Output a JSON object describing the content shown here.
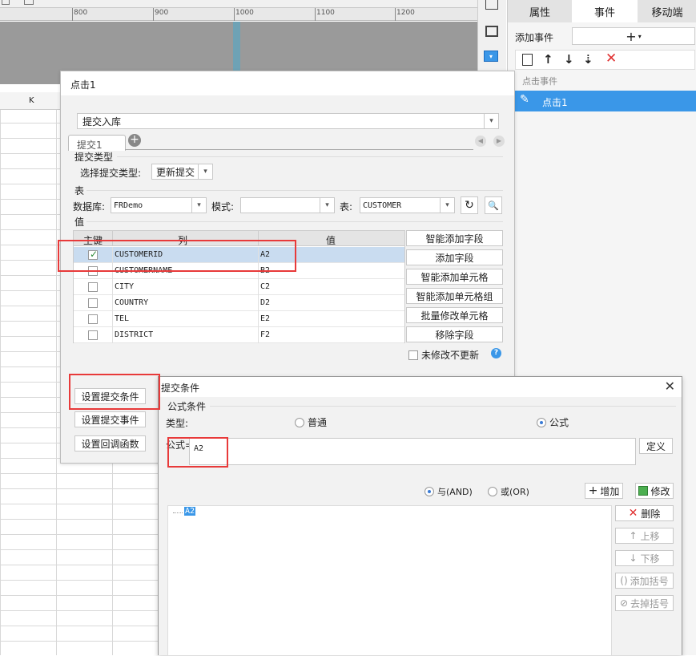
{
  "ruler": {
    "marks": [
      "800",
      "900",
      "1000",
      "1100",
      "1200"
    ]
  },
  "sheet": {
    "col_k": "K"
  },
  "right_panel": {
    "tabs": [
      "属性",
      "事件",
      "移动端"
    ],
    "add_event_label": "添加事件",
    "event_section": "点击事件",
    "event_item": "点击1"
  },
  "main_dialog": {
    "title": "点击1",
    "action_select": "提交入库",
    "tab_label": "提交1",
    "submit_type_group": "提交类型",
    "submit_type_label": "选择提交类型:",
    "submit_type_value": "更新提交",
    "table_group": "表",
    "db_label": "数据库:",
    "db_value": "FRDemo",
    "mode_label": "模式:",
    "mode_value": "",
    "table_label": "表:",
    "table_value": "CUSTOMER",
    "value_group": "值",
    "grid_headers": [
      "主键",
      "列",
      "值"
    ],
    "grid_rows": [
      {
        "key": true,
        "column": "CUSTOMERID",
        "value": "A2"
      },
      {
        "key": false,
        "column": "CUSTOMERNAME",
        "value": "B2"
      },
      {
        "key": false,
        "column": "CITY",
        "value": "C2"
      },
      {
        "key": false,
        "column": "COUNTRY",
        "value": "D2"
      },
      {
        "key": false,
        "column": "TEL",
        "value": "E2"
      },
      {
        "key": false,
        "column": "DISTRICT",
        "value": "F2"
      }
    ],
    "side_buttons": [
      "智能添加字段",
      "添加字段",
      "智能添加单元格",
      "智能添加单元格组",
      "批量修改单元格",
      "移除字段"
    ],
    "no_update_label": "未修改不更新",
    "bottom_buttons": [
      "设置提交条件",
      "设置提交事件",
      "设置回调函数"
    ]
  },
  "cond_dialog": {
    "title": "提交条件",
    "group_label": "公式条件",
    "type_label": "类型:",
    "radio_normal": "普通",
    "radio_formula": "公式",
    "formula_label": "公式=",
    "formula_value": "A2",
    "define_button": "定义",
    "and_label": "与(AND)",
    "or_label": "或(OR)",
    "add_button": "增加",
    "modify_button": "修改",
    "tree_item": "A2",
    "delete_button": "删除",
    "up_button": "上移",
    "down_button": "下移",
    "add_bracket_button": "添加括号",
    "remove_bracket_button": "去掉括号"
  },
  "colors": {
    "accent": "#3a97e8",
    "highlight_red": "#e83a3a",
    "selected_row": "#c9dcf0",
    "ruler_bg": "#9a9a9a"
  }
}
